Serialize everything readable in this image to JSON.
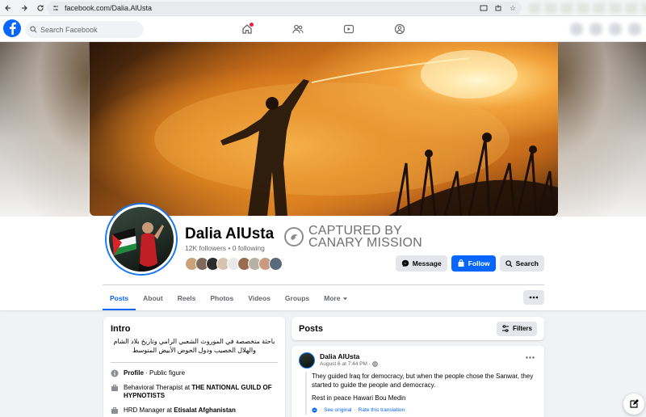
{
  "browser": {
    "url": "facebook.com/Dalia.AlUsta"
  },
  "header": {
    "search_placeholder": "Search Facebook"
  },
  "profile": {
    "name": "Dalia AlUsta",
    "stats": "12K followers • 0 following",
    "watermark_line1": "CAPTURED BY",
    "watermark_line2": "CANARY MISSION",
    "friend_avatar_colors": [
      "#c9a27a",
      "#7d6a5a",
      "#2b2b2b",
      "#d7c4b0",
      "#e9e9e9",
      "#9a6b4f",
      "#b9b1a5",
      "#c89a80",
      "#5b6a7a"
    ]
  },
  "actions": {
    "message": "Message",
    "follow": "Follow",
    "search": "Search"
  },
  "tabs": [
    {
      "label": "Posts",
      "active": true
    },
    {
      "label": "About"
    },
    {
      "label": "Reels"
    },
    {
      "label": "Photos"
    },
    {
      "label": "Videos"
    },
    {
      "label": "Groups"
    },
    {
      "label": "More"
    }
  ],
  "intro": {
    "title": "Intro",
    "bio": "باحثة متخصصة في الموروث الشعبي الرامي وتاريخ بلاد الشام والهلال الخصيب ودول الحوض الأبيض المتوسط",
    "profile_label": "Profile",
    "profile_value": " · Public figure",
    "job1_prefix": "Behavioral Therapist at ",
    "job1_org": "THE NATIONAL GUILD OF HYPNOTISTS",
    "job2_prefix": "HRD Manager at ",
    "job2_org": "Etisalat Afghanistan"
  },
  "posts": {
    "title": "Posts",
    "filters": "Filters",
    "post": {
      "author": "Dalia AlUsta",
      "time": "August 6 at 7:44 PM ·",
      "line1": "They guided Iraq for democracy, but when the people chose the Sanwar, they started to guide the people and democracy.",
      "line2": "Rest in peace Hawari Bou Medin",
      "see_original": "See original",
      "rate": "Rate this translation"
    }
  },
  "colors": {
    "brand": "#0866ff",
    "background": "#f0f2f5"
  }
}
